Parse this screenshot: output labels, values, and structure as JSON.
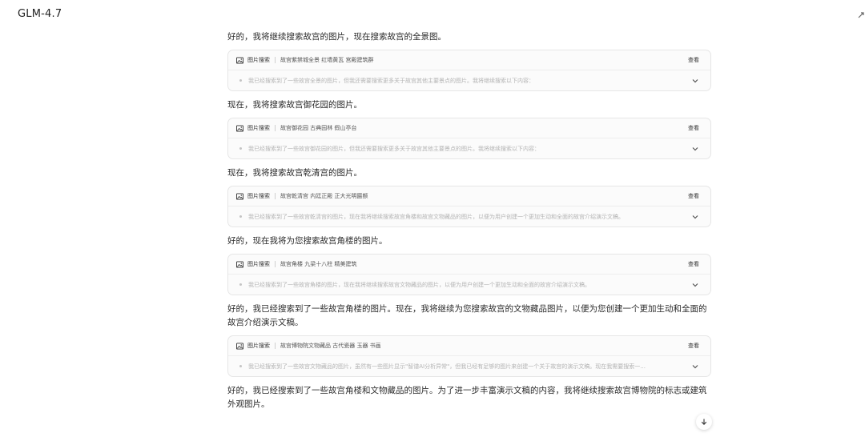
{
  "header": {
    "model_name": "GLM-4.7"
  },
  "icons": {
    "image": "image-icon",
    "chevron": "chevron-down-icon",
    "scroll": "arrow-down-icon",
    "corner": "corner-icon"
  },
  "colors": {
    "background": "#ffffff",
    "card_bg": "#fbfbfb",
    "card_border": "#e6e6e6",
    "muted_text": "#b3b3b3"
  },
  "messages": [
    {
      "text": "好的，我将继续搜索故宫的图片，现在搜索故宫的全景图。",
      "card": {
        "tool": "图片搜索",
        "query": "故宫紫禁城全景 红墙黄瓦 宫殿建筑群",
        "view": "查看",
        "summary": "我已经搜索到了一些故宫全景的图片，但我还需要搜索更多关于故宫其他主要景点的图片。我将继续搜索以下内容："
      }
    },
    {
      "text": "现在，我将搜索故宫御花园的图片。",
      "card": {
        "tool": "图片搜索",
        "query": "故宫御花园 古典园林 假山亭台",
        "view": "查看",
        "summary": "我已经搜索到了一些故宫御花园的图片，但我还需要搜索更多关于故宫其他主要景点的图片。我将继续搜索以下内容："
      }
    },
    {
      "text": "现在，我将搜索故宫乾清宫的图片。",
      "card": {
        "tool": "图片搜索",
        "query": "故宫乾清宫 内廷正殿 正大光明匾额",
        "view": "查看",
        "summary": "我已经搜索到了一些故宫乾清宫的图片，现在我将继续搜索故宫角楼和故宫文物藏品的图片，以便为用户创建一个更加生动和全面的故宫介绍演示文稿。"
      }
    },
    {
      "text": "好的，现在我将为您搜索故宫角楼的图片。",
      "card": {
        "tool": "图片搜索",
        "query": "故宫角楼 九梁十八柱 精美建筑",
        "view": "查看",
        "summary": "我已经搜索到了一些故宫角楼的图片，现在我将继续搜索故宫文物藏品的图片，以便为用户创建一个更加生动和全面的故宫介绍演示文稿。"
      }
    },
    {
      "text": "好的，我已经搜索到了一些故宫角楼的图片。现在，我将继续为您搜索故宫的文物藏品图片，以便为您创建一个更加生动和全面的故宫介绍演示文稿。",
      "card": {
        "tool": "图片搜索",
        "query": "故宫博物院文物藏品 古代瓷器 玉器 书画",
        "view": "查看",
        "summary": "我已经搜索到了一些故宫文物藏品的图片，虽然有一些图片显示\"智谱AI分析异常\"，但我已经有足够的图片来创建一个关于故宫的演示文稿。现在我需要搜索一..."
      }
    },
    {
      "text": "好的，我已经搜索到了一些故宫角楼和文物藏品的图片。为了进一步丰富演示文稿的内容，我将继续搜索故宫博物院的标志或建筑外观图片。"
    }
  ]
}
